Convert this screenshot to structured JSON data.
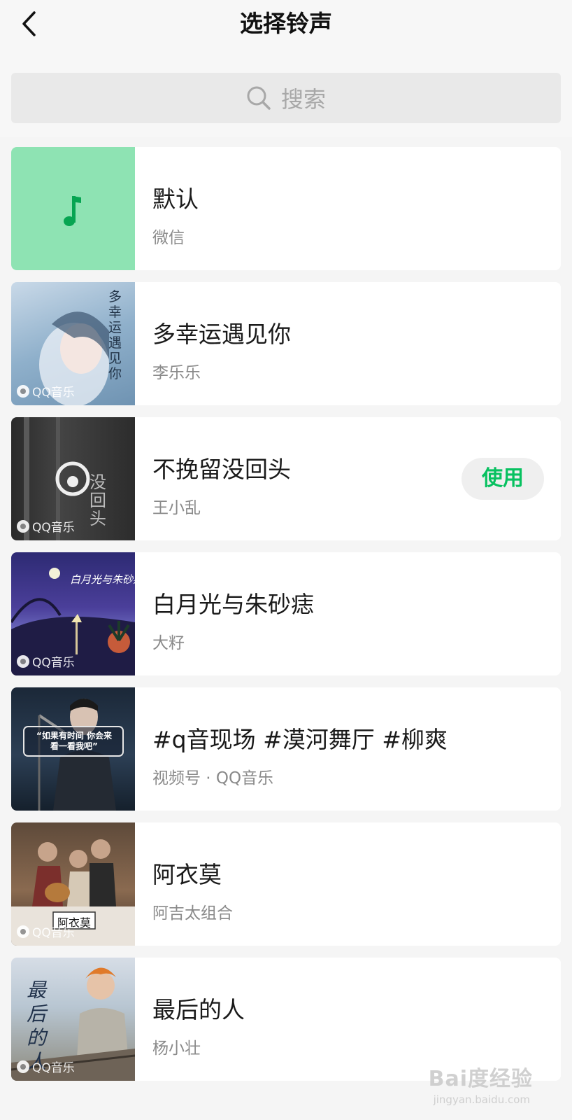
{
  "header": {
    "title": "选择铃声",
    "back_icon": "chevron-left-icon"
  },
  "search": {
    "placeholder": "搜索",
    "icon": "search-icon"
  },
  "ringtones": [
    {
      "title": "默认",
      "subtitle": "微信",
      "cover": "music-note-icon",
      "badge": ""
    },
    {
      "title": "多幸运遇见你",
      "subtitle": "李乐乐",
      "badge": "QQ音乐",
      "cover_text": "多幸运遇见你"
    },
    {
      "title": "不挽留没回头",
      "subtitle": "王小乱",
      "badge": "QQ音乐",
      "action": "使用",
      "cover_text": "没回头"
    },
    {
      "title": "白月光与朱砂痣",
      "subtitle": "大籽",
      "badge": "QQ音乐",
      "cover_text": "白月光与朱砂痣"
    },
    {
      "title": "#q音现场 #漠河舞厅 #柳爽",
      "subtitle": "视频号 · QQ音乐",
      "badge": "",
      "cover_text": "“如果有时间 你会来看一看我吧”"
    },
    {
      "title": "阿衣莫",
      "subtitle": "阿吉太组合",
      "badge": "QQ音乐",
      "cover_text": "阿衣莫"
    },
    {
      "title": "最后的人",
      "subtitle": "杨小壮",
      "badge": "QQ音乐",
      "cover_text": "最后的人"
    }
  ],
  "watermark": {
    "text": "Bai度经验",
    "url": "jingyan.baidu.com"
  },
  "colors": {
    "accent": "#07c160",
    "default_cover": "#8ee3b3"
  }
}
